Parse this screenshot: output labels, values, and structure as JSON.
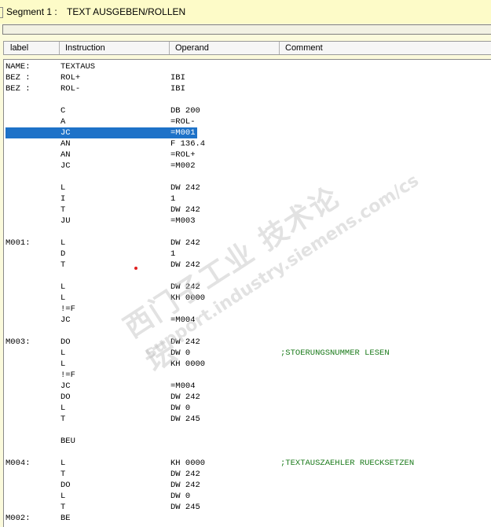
{
  "segment": {
    "label": "Segment 1 :",
    "title": "TEXT AUSGEBEN/ROLLEN"
  },
  "columns": [
    "label",
    "Instruction",
    "Operand",
    "Comment"
  ],
  "rows": [
    {
      "label": "NAME:",
      "instr": "TEXTAUS",
      "oper": "",
      "comm": ""
    },
    {
      "label": "BEZ :",
      "instr": "ROL+",
      "oper": "IBI",
      "comm": ""
    },
    {
      "label": "BEZ :",
      "instr": "ROL-",
      "oper": "IBI",
      "comm": ""
    },
    {
      "label": "",
      "instr": "",
      "oper": "",
      "comm": ""
    },
    {
      "label": "",
      "instr": "C",
      "oper": "DB 200",
      "comm": ""
    },
    {
      "label": "",
      "instr": "A",
      "oper": "=ROL-",
      "comm": ""
    },
    {
      "label": "",
      "instr": "JC",
      "oper": "=M001",
      "comm": "",
      "selected": true
    },
    {
      "label": "",
      "instr": "AN",
      "oper": "F 136.4",
      "comm": ""
    },
    {
      "label": "",
      "instr": "AN",
      "oper": "=ROL+",
      "comm": ""
    },
    {
      "label": "",
      "instr": "JC",
      "oper": "=M002",
      "comm": ""
    },
    {
      "label": "",
      "instr": "",
      "oper": "",
      "comm": ""
    },
    {
      "label": "",
      "instr": "L",
      "oper": "DW 242",
      "comm": ""
    },
    {
      "label": "",
      "instr": "I",
      "oper": "1",
      "comm": ""
    },
    {
      "label": "",
      "instr": "T",
      "oper": "DW 242",
      "comm": ""
    },
    {
      "label": "",
      "instr": "JU",
      "oper": "=M003",
      "comm": ""
    },
    {
      "label": "",
      "instr": "",
      "oper": "",
      "comm": ""
    },
    {
      "label": "M001:",
      "instr": "L",
      "oper": "DW 242",
      "comm": ""
    },
    {
      "label": "",
      "instr": "D",
      "oper": "1",
      "comm": ""
    },
    {
      "label": "",
      "instr": "T",
      "oper": "DW 242",
      "comm": ""
    },
    {
      "label": "",
      "instr": "",
      "oper": "",
      "comm": ""
    },
    {
      "label": "",
      "instr": "L",
      "oper": "DW 242",
      "comm": ""
    },
    {
      "label": "",
      "instr": "L",
      "oper": "KH 0000",
      "comm": ""
    },
    {
      "label": "",
      "instr": "!=F",
      "oper": "",
      "comm": ""
    },
    {
      "label": "",
      "instr": "JC",
      "oper": "=M004",
      "comm": ""
    },
    {
      "label": "",
      "instr": "",
      "oper": "",
      "comm": ""
    },
    {
      "label": "M003:",
      "instr": "DO",
      "oper": "DW 242",
      "comm": ""
    },
    {
      "label": "",
      "instr": "L",
      "oper": "DW 0",
      "comm": ";STOERUNGSNUMMER LESEN"
    },
    {
      "label": "",
      "instr": "L",
      "oper": "KH 0000",
      "comm": ""
    },
    {
      "label": "",
      "instr": "!=F",
      "oper": "",
      "comm": ""
    },
    {
      "label": "",
      "instr": "JC",
      "oper": "=M004",
      "comm": ""
    },
    {
      "label": "",
      "instr": "DO",
      "oper": "DW 242",
      "comm": ""
    },
    {
      "label": "",
      "instr": "L",
      "oper": "DW 0",
      "comm": ""
    },
    {
      "label": "",
      "instr": "T",
      "oper": "DW 245",
      "comm": ""
    },
    {
      "label": "",
      "instr": "",
      "oper": "",
      "comm": ""
    },
    {
      "label": "",
      "instr": "BEU",
      "oper": "",
      "comm": ""
    },
    {
      "label": "",
      "instr": "",
      "oper": "",
      "comm": ""
    },
    {
      "label": "M004:",
      "instr": "L",
      "oper": "KH 0000",
      "comm": ";TEXTAUSZAEHLER RUECKSETZEN"
    },
    {
      "label": "",
      "instr": "T",
      "oper": "DW 242",
      "comm": ""
    },
    {
      "label": "",
      "instr": "DO",
      "oper": "DW 242",
      "comm": ""
    },
    {
      "label": "",
      "instr": "L",
      "oper": "DW 0",
      "comm": ""
    },
    {
      "label": "",
      "instr": "T",
      "oper": "DW 245",
      "comm": ""
    },
    {
      "label": "M002:",
      "instr": "BE",
      "oper": "",
      "comm": ""
    }
  ],
  "watermark": {
    "main": "西门子工业  技术论坛",
    "sub": "support.industry.siemens.com/cs"
  },
  "colors": {
    "selection": "#1e72c8",
    "comment": "#1a7a1a",
    "background": "#fbfadc"
  }
}
